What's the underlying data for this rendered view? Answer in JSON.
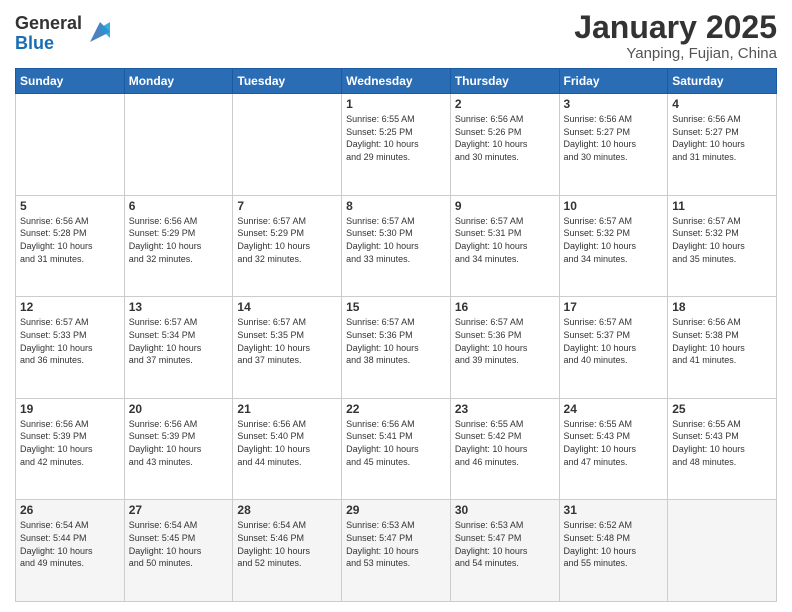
{
  "header": {
    "logo_general": "General",
    "logo_blue": "Blue",
    "month_title": "January 2025",
    "location": "Yanping, Fujian, China"
  },
  "days_of_week": [
    "Sunday",
    "Monday",
    "Tuesday",
    "Wednesday",
    "Thursday",
    "Friday",
    "Saturday"
  ],
  "weeks": [
    [
      {
        "day": "",
        "info": ""
      },
      {
        "day": "",
        "info": ""
      },
      {
        "day": "",
        "info": ""
      },
      {
        "day": "1",
        "info": "Sunrise: 6:55 AM\nSunset: 5:25 PM\nDaylight: 10 hours\nand 29 minutes."
      },
      {
        "day": "2",
        "info": "Sunrise: 6:56 AM\nSunset: 5:26 PM\nDaylight: 10 hours\nand 30 minutes."
      },
      {
        "day": "3",
        "info": "Sunrise: 6:56 AM\nSunset: 5:27 PM\nDaylight: 10 hours\nand 30 minutes."
      },
      {
        "day": "4",
        "info": "Sunrise: 6:56 AM\nSunset: 5:27 PM\nDaylight: 10 hours\nand 31 minutes."
      }
    ],
    [
      {
        "day": "5",
        "info": "Sunrise: 6:56 AM\nSunset: 5:28 PM\nDaylight: 10 hours\nand 31 minutes."
      },
      {
        "day": "6",
        "info": "Sunrise: 6:56 AM\nSunset: 5:29 PM\nDaylight: 10 hours\nand 32 minutes."
      },
      {
        "day": "7",
        "info": "Sunrise: 6:57 AM\nSunset: 5:29 PM\nDaylight: 10 hours\nand 32 minutes."
      },
      {
        "day": "8",
        "info": "Sunrise: 6:57 AM\nSunset: 5:30 PM\nDaylight: 10 hours\nand 33 minutes."
      },
      {
        "day": "9",
        "info": "Sunrise: 6:57 AM\nSunset: 5:31 PM\nDaylight: 10 hours\nand 34 minutes."
      },
      {
        "day": "10",
        "info": "Sunrise: 6:57 AM\nSunset: 5:32 PM\nDaylight: 10 hours\nand 34 minutes."
      },
      {
        "day": "11",
        "info": "Sunrise: 6:57 AM\nSunset: 5:32 PM\nDaylight: 10 hours\nand 35 minutes."
      }
    ],
    [
      {
        "day": "12",
        "info": "Sunrise: 6:57 AM\nSunset: 5:33 PM\nDaylight: 10 hours\nand 36 minutes."
      },
      {
        "day": "13",
        "info": "Sunrise: 6:57 AM\nSunset: 5:34 PM\nDaylight: 10 hours\nand 37 minutes."
      },
      {
        "day": "14",
        "info": "Sunrise: 6:57 AM\nSunset: 5:35 PM\nDaylight: 10 hours\nand 37 minutes."
      },
      {
        "day": "15",
        "info": "Sunrise: 6:57 AM\nSunset: 5:36 PM\nDaylight: 10 hours\nand 38 minutes."
      },
      {
        "day": "16",
        "info": "Sunrise: 6:57 AM\nSunset: 5:36 PM\nDaylight: 10 hours\nand 39 minutes."
      },
      {
        "day": "17",
        "info": "Sunrise: 6:57 AM\nSunset: 5:37 PM\nDaylight: 10 hours\nand 40 minutes."
      },
      {
        "day": "18",
        "info": "Sunrise: 6:56 AM\nSunset: 5:38 PM\nDaylight: 10 hours\nand 41 minutes."
      }
    ],
    [
      {
        "day": "19",
        "info": "Sunrise: 6:56 AM\nSunset: 5:39 PM\nDaylight: 10 hours\nand 42 minutes."
      },
      {
        "day": "20",
        "info": "Sunrise: 6:56 AM\nSunset: 5:39 PM\nDaylight: 10 hours\nand 43 minutes."
      },
      {
        "day": "21",
        "info": "Sunrise: 6:56 AM\nSunset: 5:40 PM\nDaylight: 10 hours\nand 44 minutes."
      },
      {
        "day": "22",
        "info": "Sunrise: 6:56 AM\nSunset: 5:41 PM\nDaylight: 10 hours\nand 45 minutes."
      },
      {
        "day": "23",
        "info": "Sunrise: 6:55 AM\nSunset: 5:42 PM\nDaylight: 10 hours\nand 46 minutes."
      },
      {
        "day": "24",
        "info": "Sunrise: 6:55 AM\nSunset: 5:43 PM\nDaylight: 10 hours\nand 47 minutes."
      },
      {
        "day": "25",
        "info": "Sunrise: 6:55 AM\nSunset: 5:43 PM\nDaylight: 10 hours\nand 48 minutes."
      }
    ],
    [
      {
        "day": "26",
        "info": "Sunrise: 6:54 AM\nSunset: 5:44 PM\nDaylight: 10 hours\nand 49 minutes."
      },
      {
        "day": "27",
        "info": "Sunrise: 6:54 AM\nSunset: 5:45 PM\nDaylight: 10 hours\nand 50 minutes."
      },
      {
        "day": "28",
        "info": "Sunrise: 6:54 AM\nSunset: 5:46 PM\nDaylight: 10 hours\nand 52 minutes."
      },
      {
        "day": "29",
        "info": "Sunrise: 6:53 AM\nSunset: 5:47 PM\nDaylight: 10 hours\nand 53 minutes."
      },
      {
        "day": "30",
        "info": "Sunrise: 6:53 AM\nSunset: 5:47 PM\nDaylight: 10 hours\nand 54 minutes."
      },
      {
        "day": "31",
        "info": "Sunrise: 6:52 AM\nSunset: 5:48 PM\nDaylight: 10 hours\nand 55 minutes."
      },
      {
        "day": "",
        "info": ""
      }
    ]
  ]
}
